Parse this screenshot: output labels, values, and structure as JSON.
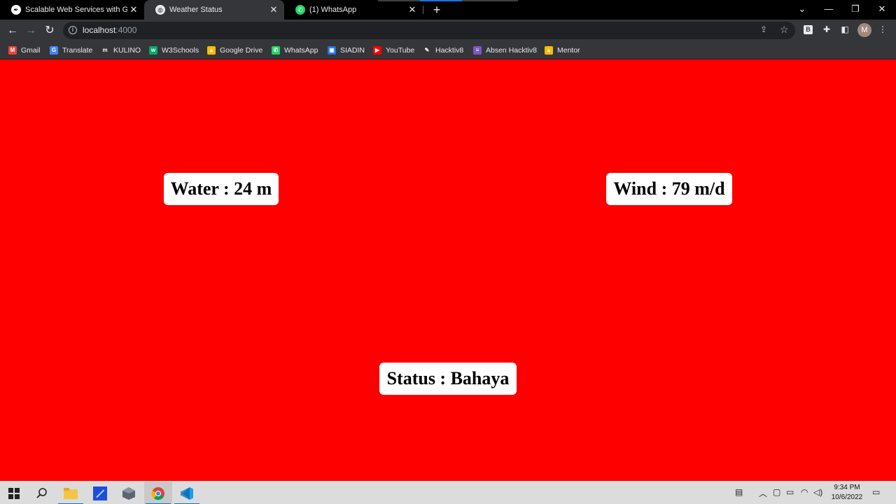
{
  "browser": {
    "tabs": [
      {
        "title": "Scalable Web Services with Golang",
        "icon": "pen-icon",
        "active": false
      },
      {
        "title": "Weather Status",
        "icon": "globe-icon",
        "active": true
      },
      {
        "title": "(1) WhatsApp",
        "icon": "whatsapp-icon",
        "active": false
      }
    ],
    "new_tab_label": "+",
    "url_host": "localhost",
    "url_port": ":4000",
    "profile_initial": "M",
    "extension_b_label": "B"
  },
  "bookmarks": [
    {
      "label": "Gmail",
      "color": "#ea4335",
      "glyph": "M"
    },
    {
      "label": "Translate",
      "color": "#4285f4",
      "glyph": "G"
    },
    {
      "label": "KULINO",
      "color": "#35363a",
      "glyph": "m"
    },
    {
      "label": "W3Schools",
      "color": "#04aa6d",
      "glyph": "w"
    },
    {
      "label": "Google Drive",
      "color": "#fbbc04",
      "glyph": "▲"
    },
    {
      "label": "WhatsApp",
      "color": "#25d366",
      "glyph": "✆"
    },
    {
      "label": "SIADIN",
      "color": "#1a73e8",
      "glyph": "▣"
    },
    {
      "label": "YouTube",
      "color": "#ff0000",
      "glyph": "▶"
    },
    {
      "label": "Hacktiv8",
      "color": "#35363a",
      "glyph": "✎"
    },
    {
      "label": "Absen Hacktiv8",
      "color": "#7e57c2",
      "glyph": "≡"
    },
    {
      "label": "Mentor",
      "color": "#fbbc04",
      "glyph": "▲"
    }
  ],
  "page": {
    "background": "#ff0000",
    "water_label": "Water : 24 m",
    "wind_label": "Wind : 79 m/d",
    "status_label": "Status : Bahaya"
  },
  "taskbar": {
    "time": "9:34 PM",
    "date": "10/6/2022"
  }
}
